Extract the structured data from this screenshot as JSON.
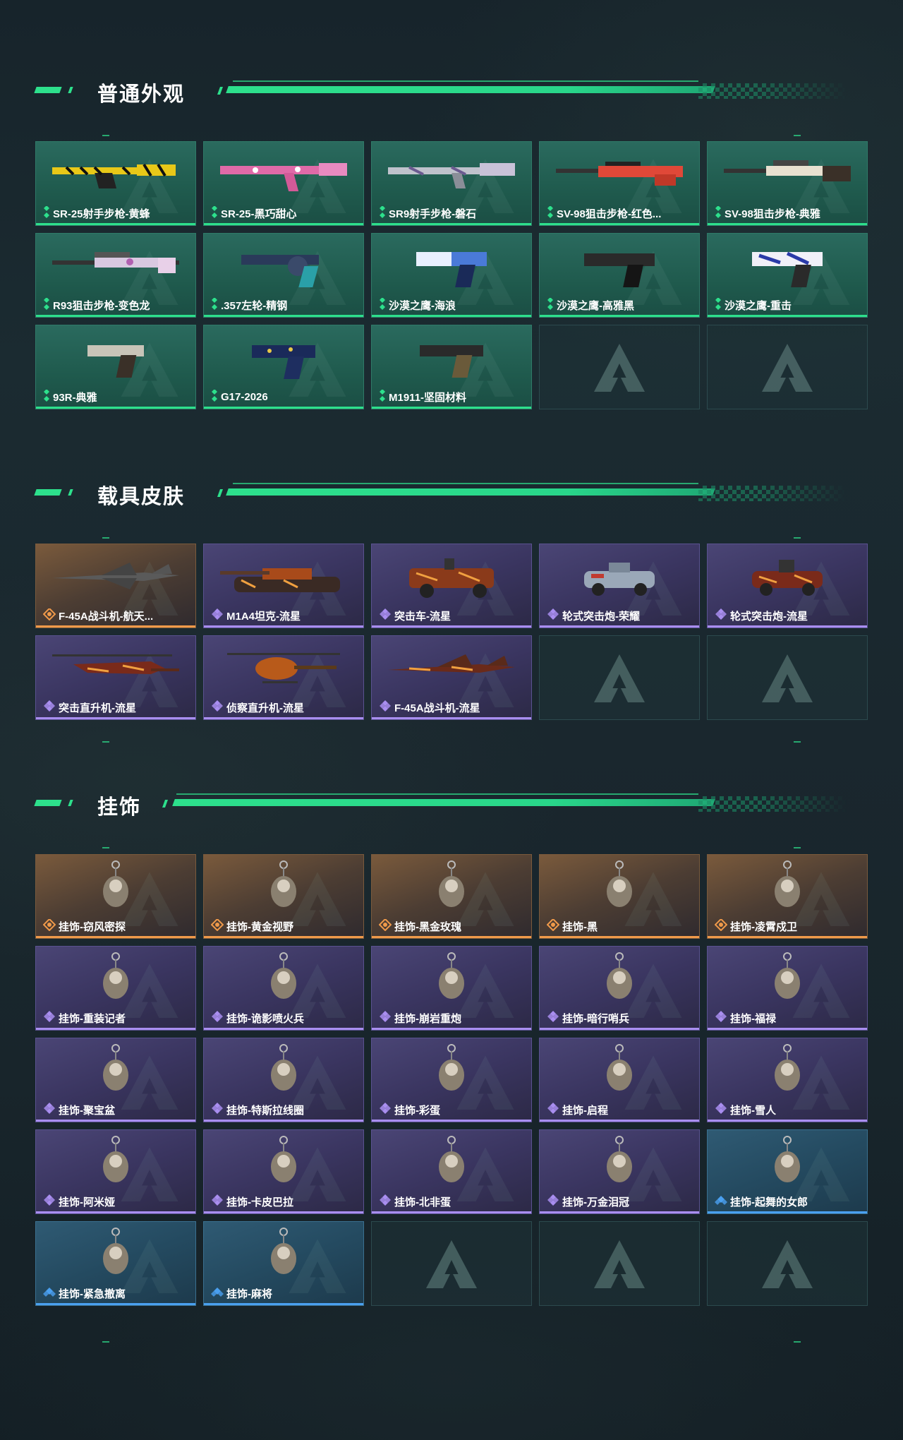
{
  "colors": {
    "accent": "#2de08c",
    "rarity_gold": "#2de08c",
    "rarity_legend": "#f09a4a",
    "rarity_epic": "#a98ef0",
    "rarity_rare": "#4aa0f0"
  },
  "sections": [
    {
      "title": "普通外观",
      "items": [
        {
          "label": "SR-25射手步枪-黄蜂",
          "rarity": "gold",
          "icon": "rifle-yellow-icon"
        },
        {
          "label": "SR-25-黑巧甜心",
          "rarity": "gold",
          "icon": "rifle-pink-icon"
        },
        {
          "label": "SR9射手步枪-磐石",
          "rarity": "gold",
          "icon": "rifle-grey-icon"
        },
        {
          "label": "SV-98狙击步枪-红色...",
          "rarity": "gold",
          "icon": "sniper-red-icon"
        },
        {
          "label": "SV-98狙击步枪-典雅",
          "rarity": "gold",
          "icon": "sniper-white-icon"
        },
        {
          "label": "R93狙击步枪-变色龙",
          "rarity": "gold",
          "icon": "sniper-chameleon-icon"
        },
        {
          "label": ".357左轮-精钢",
          "rarity": "gold",
          "icon": "revolver-icon"
        },
        {
          "label": "沙漠之鹰-海浪",
          "rarity": "gold",
          "icon": "pistol-blue-icon"
        },
        {
          "label": "沙漠之鹰-高雅黑",
          "rarity": "gold",
          "icon": "pistol-black-icon"
        },
        {
          "label": "沙漠之鹰-重击",
          "rarity": "gold",
          "icon": "pistol-white-icon"
        },
        {
          "label": "93R-典雅",
          "rarity": "gold",
          "icon": "pistol-silver-icon"
        },
        {
          "label": "G17-2026",
          "rarity": "gold",
          "icon": "pistol-navy-icon"
        },
        {
          "label": "M1911-坚固材料",
          "rarity": "gold",
          "icon": "pistol-brown-icon"
        },
        {
          "empty": true
        },
        {
          "empty": true
        }
      ]
    },
    {
      "title": "载具皮肤",
      "items": [
        {
          "label": "F-45A战斗机-航天...",
          "rarity": "legend",
          "icon": "fighter-jet-icon"
        },
        {
          "label": "M1A4坦克-流星",
          "rarity": "epic",
          "icon": "tank-icon"
        },
        {
          "label": "突击车-流星",
          "rarity": "epic",
          "icon": "assault-vehicle-icon"
        },
        {
          "label": "轮式突击炮-荣耀",
          "rarity": "epic",
          "icon": "wheeled-gun-icon"
        },
        {
          "label": "轮式突击炮-流星",
          "rarity": "epic",
          "icon": "wheeled-gun-fire-icon"
        },
        {
          "label": "突击直升机-流星",
          "rarity": "epic",
          "icon": "attack-helicopter-icon"
        },
        {
          "label": "侦察直升机-流星",
          "rarity": "epic",
          "icon": "scout-helicopter-icon"
        },
        {
          "label": "F-45A战斗机-流星",
          "rarity": "epic",
          "icon": "fighter-jet-fire-icon"
        },
        {
          "empty": true
        },
        {
          "empty": true
        }
      ]
    },
    {
      "title": "挂饰",
      "items": [
        {
          "label": "挂饰-窃风密探",
          "rarity": "legend",
          "icon": "charm-icon"
        },
        {
          "label": "挂饰-黄金视野",
          "rarity": "legend",
          "icon": "charm-icon"
        },
        {
          "label": "挂饰-黑金玫瑰",
          "rarity": "legend",
          "icon": "charm-icon"
        },
        {
          "label": "挂饰-黑",
          "rarity": "legend",
          "icon": "charm-icon"
        },
        {
          "label": "挂饰-凌霄戍卫",
          "rarity": "legend",
          "icon": "charm-icon"
        },
        {
          "label": "挂饰-重装记者",
          "rarity": "epic",
          "icon": "charm-icon"
        },
        {
          "label": "挂饰-诡影喷火兵",
          "rarity": "epic",
          "icon": "charm-icon"
        },
        {
          "label": "挂饰-崩岩重炮",
          "rarity": "epic",
          "icon": "charm-icon"
        },
        {
          "label": "挂饰-暗行哨兵",
          "rarity": "epic",
          "icon": "charm-icon"
        },
        {
          "label": "挂饰-福禄",
          "rarity": "epic",
          "icon": "charm-icon"
        },
        {
          "label": "挂饰-聚宝盆",
          "rarity": "epic",
          "icon": "charm-icon"
        },
        {
          "label": "挂饰-特斯拉线圈",
          "rarity": "epic",
          "icon": "charm-icon"
        },
        {
          "label": "挂饰-彩蛋",
          "rarity": "epic",
          "icon": "charm-icon"
        },
        {
          "label": "挂饰-启程",
          "rarity": "epic",
          "icon": "charm-icon"
        },
        {
          "label": "挂饰-雪人",
          "rarity": "epic",
          "icon": "charm-icon"
        },
        {
          "label": "挂饰-阿米娅",
          "rarity": "epic",
          "icon": "charm-icon"
        },
        {
          "label": "挂饰-卡皮巴拉",
          "rarity": "epic",
          "icon": "charm-icon"
        },
        {
          "label": "挂饰-北非蛋",
          "rarity": "epic",
          "icon": "charm-icon"
        },
        {
          "label": "挂饰-万金泪冠",
          "rarity": "epic",
          "icon": "charm-icon"
        },
        {
          "label": "挂饰-起舞的女郎",
          "rarity": "rare",
          "icon": "charm-icon"
        },
        {
          "label": "挂饰-紧急撤离",
          "rarity": "rare",
          "icon": "charm-icon"
        },
        {
          "label": "挂饰-麻将",
          "rarity": "rare",
          "icon": "charm-icon"
        },
        {
          "empty": true
        },
        {
          "empty": true
        },
        {
          "empty": true
        }
      ]
    }
  ]
}
